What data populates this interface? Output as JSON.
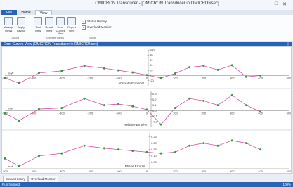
{
  "window": {
    "title": "OMICRON Transducer - [OMICRON Transducer in OMICRONsec]"
  },
  "tabs": [
    "File",
    "Home",
    "View"
  ],
  "ribbon": {
    "buttons": [
      {
        "label": "Manage Views"
      },
      {
        "label": "Apply Layout"
      },
      {
        "label": "Tool View"
      },
      {
        "label": "Result View"
      },
      {
        "label": "Error Curves View"
      },
      {
        "label": "Report View"
      }
    ],
    "groups": [
      "Layout",
      "Activate Views",
      "Show"
    ],
    "checks": [
      {
        "label": "Status History",
        "checked": true
      },
      {
        "label": "Overload Monitor",
        "checked": true
      }
    ]
  },
  "panel": {
    "title": "Error Curves View (OMICRON Transducer in OMICRONsec)"
  },
  "chart_data": [
    {
      "type": "line",
      "label": "Absolute Error/mV",
      "ylabel": "m/W",
      "yticks": [
        "100",
        "80",
        "60",
        "40",
        "20",
        "0",
        "-20"
      ],
      "xticks": [
        "-500",
        "-400",
        "-300",
        "-200",
        "-100",
        "0",
        "100",
        "200",
        "300",
        "400",
        "500"
      ],
      "xlim": [
        -500,
        500
      ],
      "ylim": [
        -40,
        100
      ],
      "series": [
        {
          "color": "#d4389a",
          "x": [
            -500,
            -450,
            -380,
            -300,
            -220,
            -150,
            -100,
            -50,
            0,
            50,
            100,
            150,
            200,
            250,
            300,
            350,
            400
          ],
          "y": [
            -10,
            -30,
            10,
            18,
            38,
            28,
            20,
            12,
            2,
            -10,
            8,
            32,
            38,
            22,
            40,
            -5,
            0
          ]
        }
      ]
    },
    {
      "type": "line",
      "label": "Relative Error/%",
      "ylabel": "m/W",
      "yticks": [
        "0.3",
        "0.2",
        "0.1",
        "0.0",
        "-0.1",
        "-0.2"
      ],
      "xticks": [
        "-500",
        "-400",
        "-300",
        "-200",
        "-100",
        "0",
        "100",
        "200",
        "300",
        "400",
        "500"
      ],
      "xlim": [
        -500,
        500
      ],
      "ylim": [
        -0.3,
        0.35
      ],
      "series": [
        {
          "color": "#d4389a",
          "x": [
            -500,
            -450,
            -380,
            -300,
            -220,
            -150,
            -100,
            -50,
            0,
            50,
            100,
            150,
            200,
            250,
            300,
            350,
            400
          ],
          "y": [
            -0.05,
            -0.18,
            0.03,
            0.05,
            0.22,
            0.1,
            0.12,
            0.08,
            0.02,
            -0.25,
            0.05,
            0.22,
            0.18,
            0.1,
            0.28,
            0.1,
            -0.02
          ]
        }
      ]
    },
    {
      "type": "line",
      "label": "Phase Error/%",
      "ylabel": "m/W",
      "yticks": [
        "0.25",
        "0.20",
        "0.15",
        "0.10",
        "0.05"
      ],
      "xticks": [
        "-500",
        "-400",
        "-300",
        "-200",
        "-100",
        "0",
        "100",
        "200",
        "300",
        "400",
        "500"
      ],
      "xlim": [
        -500,
        500
      ],
      "ylim": [
        0.0,
        0.28
      ],
      "series": [
        {
          "color": "#d4389a",
          "x": [
            -500,
            -450,
            -380,
            -300,
            -220,
            -150,
            -100,
            -50,
            0,
            50,
            100,
            150,
            200,
            250,
            300,
            350,
            400
          ],
          "y": [
            0.08,
            0.02,
            0.1,
            0.12,
            0.18,
            0.16,
            0.15,
            0.14,
            0.13,
            0.12,
            0.13,
            0.18,
            0.2,
            0.18,
            0.22,
            0.2,
            0.15
          ]
        }
      ]
    }
  ],
  "status": {
    "tabs": [
      "Status History",
      "Overload Monitor"
    ],
    "left": "Run finished",
    "right": "100%"
  }
}
